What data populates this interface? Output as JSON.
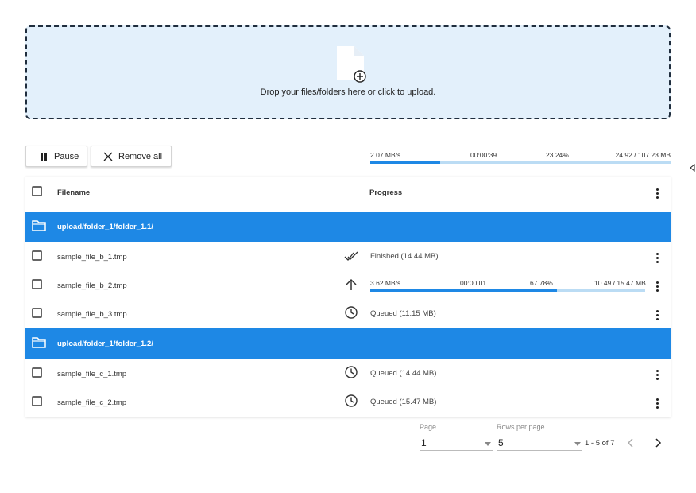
{
  "dropzone": {
    "text": "Drop your files/folders here or click to upload.",
    "icon": "file-add-icon"
  },
  "toolbar": {
    "pause_label": "Pause",
    "remove_all_label": "Remove all"
  },
  "overall_progress": {
    "speed": "2.07 MB/s",
    "eta": "00:00:39",
    "percent": "23.24%",
    "size": "24.92 / 107.23 MB",
    "fraction": 0.2324
  },
  "table": {
    "headers": {
      "filename": "Filename",
      "progress": "Progress"
    },
    "groups": [
      {
        "folder": "upload/folder_1/folder_1.1/",
        "files": [
          {
            "name": "sample_file_b_1.tmp",
            "status_icon": "done-all-icon",
            "status": "Finished (14.44 MB)"
          },
          {
            "name": "sample_file_b_2.tmp",
            "status_icon": "arrow-up-icon",
            "progress": {
              "speed": "3.62 MB/s",
              "eta": "00:00:01",
              "percent": "67.78%",
              "size": "10.49 / 15.47 MB",
              "fraction": 0.6778
            }
          },
          {
            "name": "sample_file_b_3.tmp",
            "status_icon": "clock-icon",
            "status": "Queued (11.15 MB)"
          }
        ]
      },
      {
        "folder": "upload/folder_1/folder_1.2/",
        "files": [
          {
            "name": "sample_file_c_1.tmp",
            "status_icon": "clock-icon",
            "status": "Queued (14.44 MB)"
          },
          {
            "name": "sample_file_c_2.tmp",
            "status_icon": "clock-icon",
            "status": "Queued (15.47 MB)"
          }
        ]
      }
    ]
  },
  "pagination": {
    "page_label": "Page",
    "page_value": "1",
    "rows_label": "Rows per page",
    "rows_value": "5",
    "range": "1 - 5 of 7"
  },
  "colors": {
    "accent": "#1e88e5",
    "dropzone_bg": "#e3f0fb",
    "progress_track": "#bbdcf4"
  }
}
